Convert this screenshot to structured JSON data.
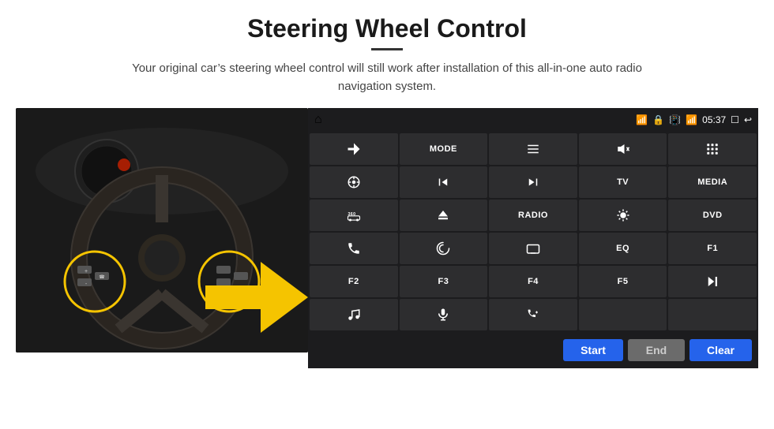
{
  "header": {
    "title": "Steering Wheel Control",
    "subtitle": "Your original car’s steering wheel control will still work after installation of this all-in-one auto radio navigation system."
  },
  "status_bar": {
    "left_icon": "home",
    "wifi_icon": "wifi",
    "lock_icon": "lock",
    "sim_icon": "sim",
    "bluetooth_icon": "bluetooth",
    "time": "05:37",
    "screen_icon": "screen",
    "back_icon": "back"
  },
  "buttons": [
    {
      "icon": "send",
      "label": "",
      "row": 1,
      "col": 1
    },
    {
      "label": "MODE",
      "row": 1,
      "col": 2
    },
    {
      "icon": "list",
      "label": "",
      "row": 1,
      "col": 3
    },
    {
      "icon": "mute",
      "label": "",
      "row": 1,
      "col": 4
    },
    {
      "icon": "apps",
      "label": "",
      "row": 1,
      "col": 5
    },
    {
      "icon": "settings-circle",
      "label": "",
      "row": 2,
      "col": 1
    },
    {
      "icon": "prev",
      "label": "",
      "row": 2,
      "col": 2
    },
    {
      "icon": "next",
      "label": "",
      "row": 2,
      "col": 3
    },
    {
      "label": "TV",
      "row": 2,
      "col": 4
    },
    {
      "label": "MEDIA",
      "row": 2,
      "col": 5
    },
    {
      "icon": "360-car",
      "label": "",
      "row": 3,
      "col": 1
    },
    {
      "icon": "eject",
      "label": "",
      "row": 3,
      "col": 2
    },
    {
      "label": "RADIO",
      "row": 3,
      "col": 3
    },
    {
      "icon": "brightness",
      "label": "",
      "row": 3,
      "col": 4
    },
    {
      "label": "DVD",
      "row": 3,
      "col": 5
    },
    {
      "icon": "phone",
      "label": "",
      "row": 4,
      "col": 1
    },
    {
      "icon": "swirl",
      "label": "",
      "row": 4,
      "col": 2
    },
    {
      "icon": "screen-mini",
      "label": "",
      "row": 4,
      "col": 3
    },
    {
      "label": "EQ",
      "row": 4,
      "col": 4
    },
    {
      "label": "F1",
      "row": 4,
      "col": 5
    },
    {
      "label": "F2",
      "row": 5,
      "col": 1
    },
    {
      "label": "F3",
      "row": 5,
      "col": 2
    },
    {
      "label": "F4",
      "row": 5,
      "col": 3
    },
    {
      "label": "F5",
      "row": 5,
      "col": 4
    },
    {
      "icon": "play-pause",
      "label": "",
      "row": 5,
      "col": 5
    },
    {
      "icon": "music",
      "label": "",
      "row": 6,
      "col": 1
    },
    {
      "icon": "mic",
      "label": "",
      "row": 6,
      "col": 2
    },
    {
      "icon": "vol-phone",
      "label": "",
      "row": 6,
      "col": 3
    },
    {
      "label": "",
      "row": 6,
      "col": 4
    },
    {
      "label": "",
      "row": 6,
      "col": 5
    }
  ],
  "action_bar": {
    "start_label": "Start",
    "end_label": "End",
    "clear_label": "Clear"
  }
}
